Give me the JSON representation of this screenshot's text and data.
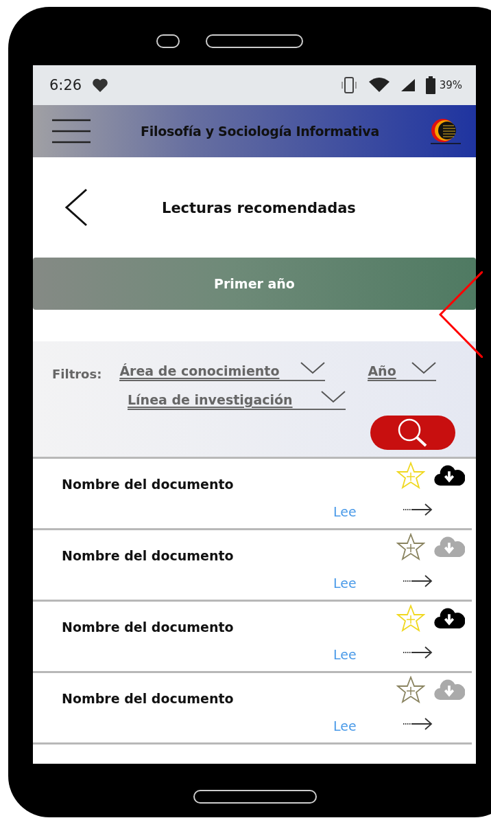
{
  "status_bar": {
    "time": "6:26",
    "battery": "39%"
  },
  "app_bar": {
    "title": "Filosofía y Sociología Informativa"
  },
  "page": {
    "title": "Lecturas recomendadas"
  },
  "banner": {
    "label": "Primer año"
  },
  "filters": {
    "label": "Filtros:",
    "dropdowns": [
      {
        "label": "Área de conocimiento"
      },
      {
        "label": "Año"
      },
      {
        "label": "Línea de investigación"
      }
    ]
  },
  "documents": [
    {
      "name": "Nombre del documento",
      "link": "Lee",
      "favorite": true,
      "downloaded": true
    },
    {
      "name": "Nombre del documento",
      "link": "Lee",
      "favorite": false,
      "downloaded": false
    },
    {
      "name": "Nombre del documento",
      "link": "Lee",
      "favorite": true,
      "downloaded": true
    },
    {
      "name": "Nombre del documento",
      "link": "Lee",
      "favorite": false,
      "downloaded": false
    }
  ]
}
